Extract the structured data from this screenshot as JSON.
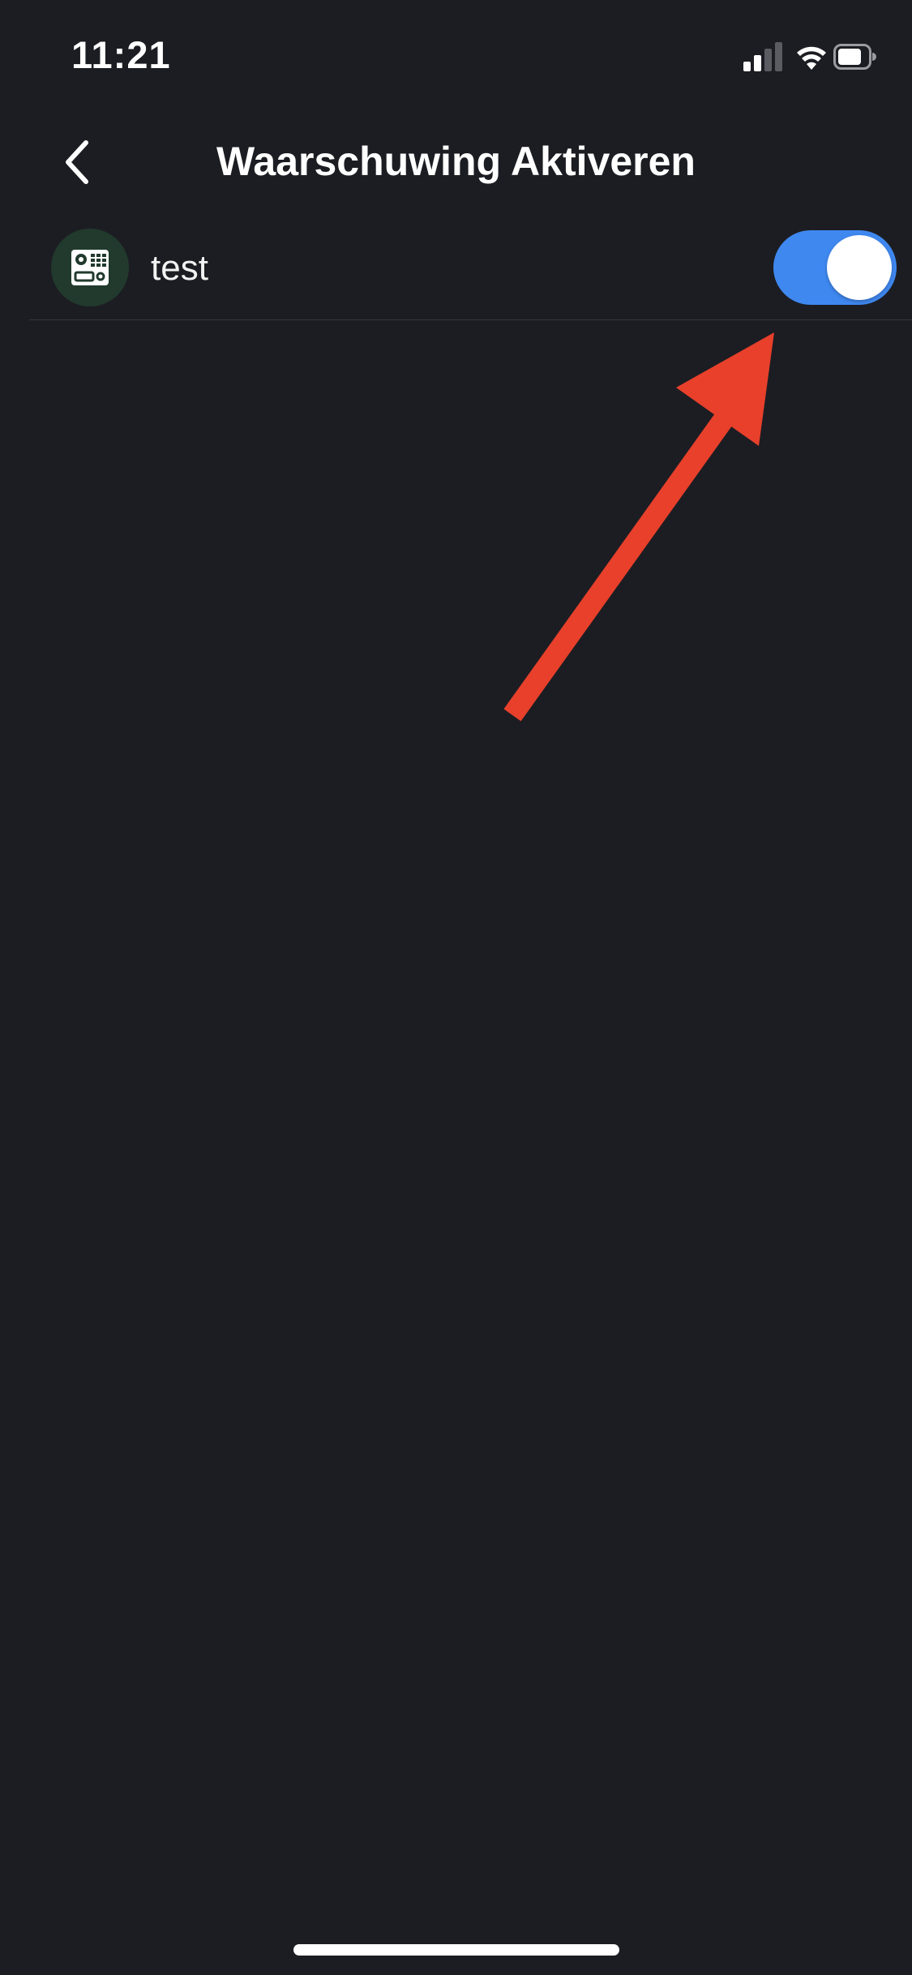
{
  "status_bar": {
    "time": "11:21",
    "icons": [
      "cellular-signal-icon",
      "wifi-icon",
      "battery-icon"
    ]
  },
  "nav": {
    "title": "Waarschuwing Aktiveren",
    "back_icon": "chevron-left-icon"
  },
  "list": {
    "items": [
      {
        "name": "test",
        "icon": "device-panel-icon",
        "toggle_on": true
      }
    ]
  },
  "colors": {
    "background": "#1c1d22",
    "toggle_on": "#3f88f0",
    "avatar_bg": "#213a2d",
    "annotation_arrow": "#e8402b"
  }
}
